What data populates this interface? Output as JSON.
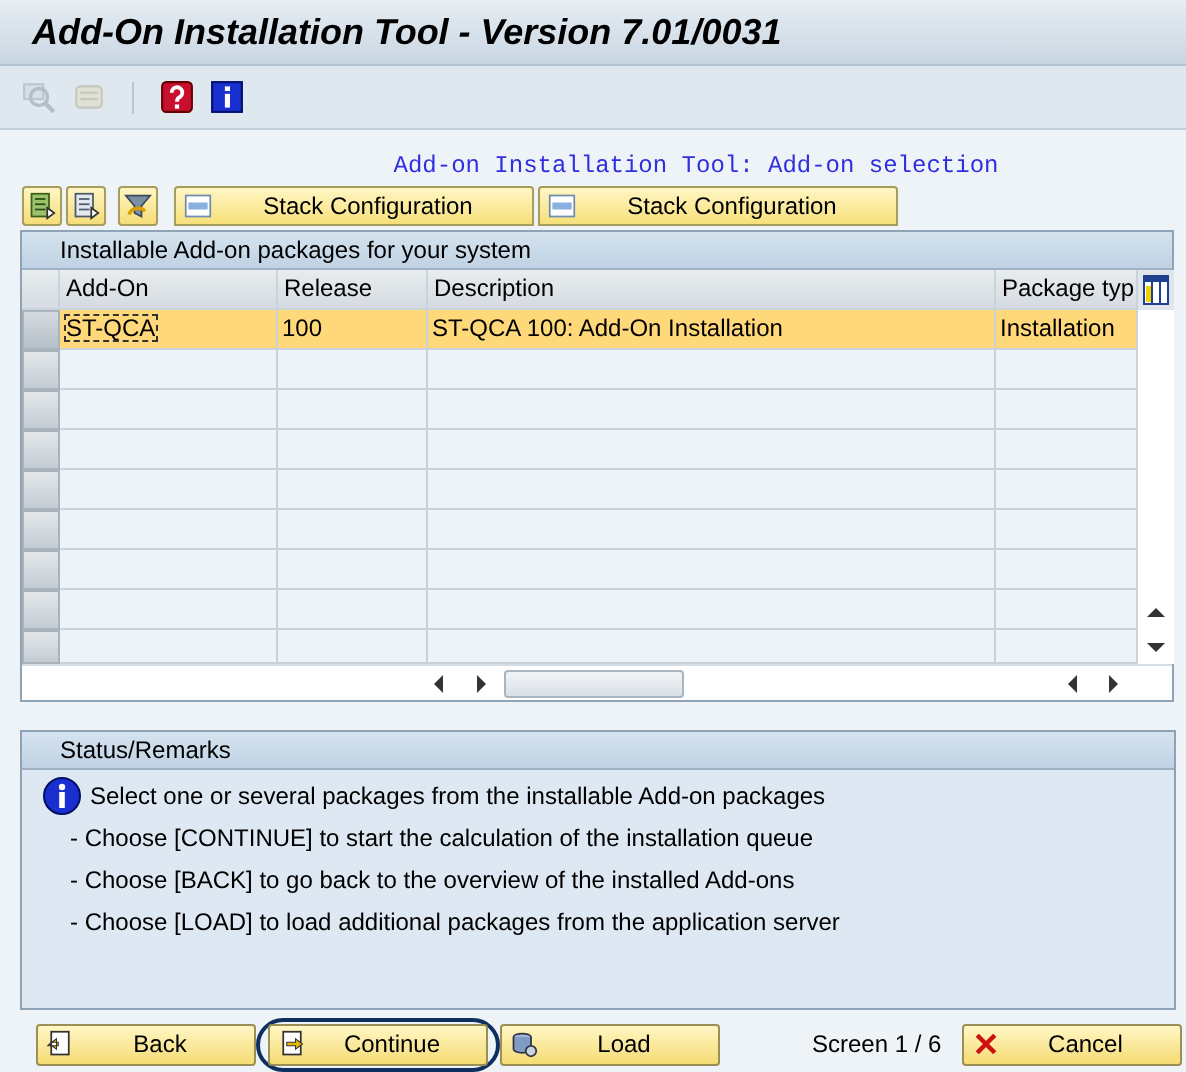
{
  "window": {
    "title": "Add-On Installation Tool - Version 7.01/0031"
  },
  "toolbar": [
    {
      "kind": "find",
      "disabled": true
    },
    {
      "kind": "scroll",
      "disabled": true
    },
    {
      "kind": "separator",
      "disabled": false
    },
    {
      "kind": "help",
      "disabled": false
    },
    {
      "kind": "info",
      "disabled": false
    }
  ],
  "subtitle": "Add-on Installation Tool: Add-on selection",
  "action_buttons": [
    {
      "kind": "icon-list"
    },
    {
      "kind": "icon-doc"
    },
    {
      "kind": "icon-filter"
    },
    {
      "kind": "xml",
      "label": "Stack Configuration"
    },
    {
      "kind": "xml",
      "label": "Stack Configuration"
    }
  ],
  "table": {
    "title": "Installable Add-on packages for your system",
    "columns": [
      "Add-On",
      "Release",
      "Description",
      "Package typ"
    ],
    "rows": [
      {
        "selected": true,
        "cells": [
          "ST-QCA",
          "100",
          "ST-QCA 100: Add-On Installation",
          "Installation"
        ]
      }
    ]
  },
  "status": {
    "title": "Status/Remarks",
    "messages": [
      {
        "kind": "info",
        "text": "Select one or several packages from the installable Add-on packages"
      },
      {
        "kind": "plain",
        "text": "- Choose [CONTINUE] to start the calculation of the installation queue"
      },
      {
        "kind": "plain",
        "text": "- Choose [BACK] to go back to the overview of the installed Add-ons"
      },
      {
        "kind": "plain",
        "text": "- Choose [LOAD] to load additional packages from the application server"
      }
    ]
  },
  "footer": {
    "buttons": [
      {
        "kind": "back",
        "label": "Back",
        "highlighted": false
      },
      {
        "kind": "continue",
        "label": "Continue",
        "highlighted": true
      },
      {
        "kind": "load",
        "label": "Load",
        "highlighted": false
      }
    ],
    "page_indicator": "Screen 1 / 6",
    "cancel_button": {
      "label": "Cancel"
    }
  }
}
